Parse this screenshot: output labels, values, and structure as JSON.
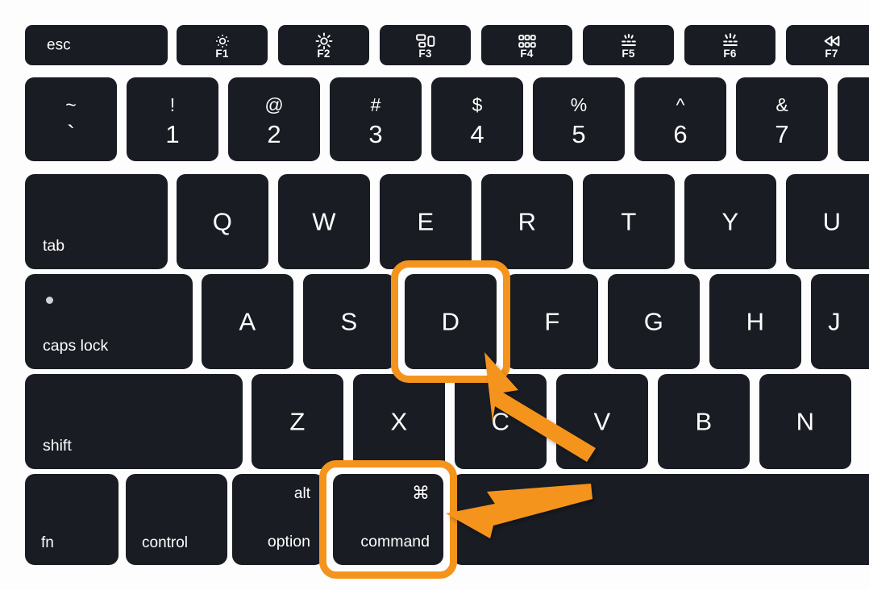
{
  "theme": {
    "key_color": "#191C23",
    "key_text_color": "#FEFEFE",
    "background": "#FDFDFD",
    "highlight_color": "#F5941D",
    "highlight_inner_color": "#FFFFFF",
    "caps_indicator_color": "#CDD2DA"
  },
  "keyboard": {
    "device": "mac-keyboard",
    "annotation": {
      "highlighted_keys": [
        "D",
        "command"
      ],
      "arrow_count": 2,
      "arrow_color": "#F5941D",
      "description": "Two orange arrows point to the highlighted D key and the highlighted command key"
    },
    "rows": {
      "function_row": {
        "name": "function-row",
        "keys": [
          {
            "id": "esc",
            "label": "esc",
            "icon": null,
            "fn_label": null
          },
          {
            "id": "f1",
            "label": null,
            "icon": "brightness-down-icon",
            "fn_label": "F1"
          },
          {
            "id": "f2",
            "label": null,
            "icon": "brightness-up-icon",
            "fn_label": "F2"
          },
          {
            "id": "f3",
            "label": null,
            "icon": "mission-control-icon",
            "fn_label": "F3"
          },
          {
            "id": "f4",
            "label": null,
            "icon": "launchpad-icon",
            "fn_label": "F4"
          },
          {
            "id": "f5",
            "label": null,
            "icon": "keyboard-light-down-icon",
            "fn_label": "F5"
          },
          {
            "id": "f6",
            "label": null,
            "icon": "keyboard-light-up-icon",
            "fn_label": "F6"
          },
          {
            "id": "f7",
            "label": null,
            "icon": "rewind-icon",
            "fn_label": "F7"
          }
        ]
      },
      "number_row": {
        "name": "number-row",
        "keys": [
          {
            "id": "backtick",
            "upper": "~",
            "lower": "`"
          },
          {
            "id": "one",
            "upper": "!",
            "lower": "1"
          },
          {
            "id": "two",
            "upper": "@",
            "lower": "2"
          },
          {
            "id": "three",
            "upper": "#",
            "lower": "3"
          },
          {
            "id": "four",
            "upper": "$",
            "lower": "4"
          },
          {
            "id": "five",
            "upper": "%",
            "lower": "5"
          },
          {
            "id": "six",
            "upper": "^",
            "lower": "6"
          },
          {
            "id": "seven",
            "upper": "&",
            "lower": "7"
          },
          {
            "id": "eight",
            "upper": "",
            "lower": ""
          }
        ]
      },
      "top_letter_row": {
        "name": "tab-row",
        "keys": [
          {
            "id": "tab",
            "label": "tab"
          },
          {
            "id": "q",
            "label": "Q"
          },
          {
            "id": "w",
            "label": "W"
          },
          {
            "id": "e",
            "label": "E"
          },
          {
            "id": "r",
            "label": "R"
          },
          {
            "id": "t",
            "label": "T"
          },
          {
            "id": "y",
            "label": "Y"
          },
          {
            "id": "u",
            "label": "U"
          }
        ]
      },
      "home_row": {
        "name": "caps-lock-row",
        "keys": [
          {
            "id": "capslock",
            "label": "caps lock",
            "indicator": true
          },
          {
            "id": "a",
            "label": "A"
          },
          {
            "id": "s",
            "label": "S"
          },
          {
            "id": "d",
            "label": "D",
            "highlighted": true
          },
          {
            "id": "f",
            "label": "F"
          },
          {
            "id": "g",
            "label": "G"
          },
          {
            "id": "h",
            "label": "H"
          },
          {
            "id": "j",
            "label": "J"
          }
        ]
      },
      "bottom_letter_row": {
        "name": "shift-row",
        "keys": [
          {
            "id": "shift",
            "label": "shift"
          },
          {
            "id": "z",
            "label": "Z"
          },
          {
            "id": "x",
            "label": "X"
          },
          {
            "id": "c",
            "label": "C"
          },
          {
            "id": "v",
            "label": "V"
          },
          {
            "id": "b",
            "label": "B"
          },
          {
            "id": "n",
            "label": "N"
          }
        ]
      },
      "modifier_row": {
        "name": "modifier-row",
        "keys": [
          {
            "id": "fn",
            "label": "fn",
            "upper": null
          },
          {
            "id": "control",
            "label": "control",
            "upper": null
          },
          {
            "id": "option",
            "label": "option",
            "upper": "alt"
          },
          {
            "id": "command",
            "label": "command",
            "upper": "⌘",
            "highlighted": true
          },
          {
            "id": "space",
            "label": "",
            "upper": null
          }
        ]
      }
    }
  }
}
